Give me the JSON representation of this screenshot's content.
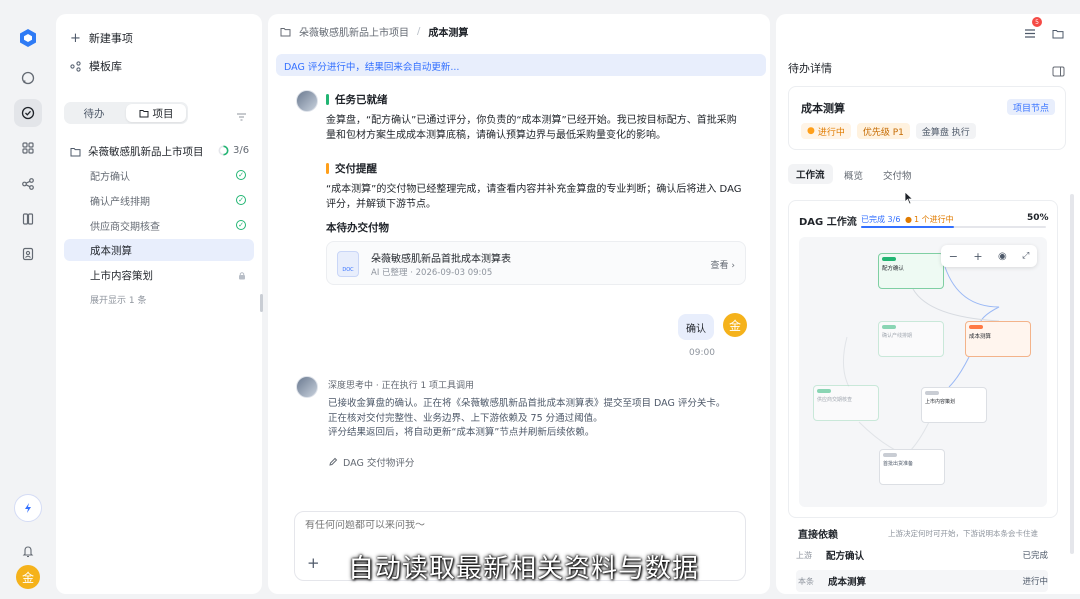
{
  "sidebar": {
    "new_item": "新建事项",
    "templates": "模板库",
    "tab_todo": "待办",
    "tab_project": "项目",
    "project_name": "朵薇敏感肌新品上市项目",
    "project_progress": "3/6",
    "tasks": [
      {
        "label": "配方确认",
        "state": "done"
      },
      {
        "label": "确认产线排期",
        "state": "done"
      },
      {
        "label": "供应商交期核查",
        "state": "done"
      },
      {
        "label": "成本测算",
        "state": "current"
      },
      {
        "label": "上市内容策划",
        "state": "locked"
      }
    ],
    "expand_more": "展开显示 1 条"
  },
  "breadcrumb": {
    "project": "朵薇敏感肌新品上市项目",
    "separator": "/",
    "current": "成本测算",
    "notif_count": "5"
  },
  "banner": "DAG 评分进行中，结果回来会自动更新...",
  "messages": {
    "task_ready_title": "任务已就绪",
    "task_ready_body": "金算盘，“配方确认”已通过评分，你负责的“成本测算”已经开始。我已按目标配方、首批采购量和包材方案生成成本测算底稿，请确认预算边界与最低采购量变化的影响。",
    "delivery_title": "交付提醒",
    "delivery_body": "“成本测算”的交付物已经整理完成，请查看内容并补充金算盘的专业判断；确认后将进入 DAG 评分，并解锁下游节点。",
    "deliverables_title": "本待办交付物",
    "file_name": "朵薇敏感肌新品首批成本测算表",
    "file_meta": "AI 已整理 · 2026-09-03 09:05",
    "file_view": "查看 ›",
    "file_badge": "DOC",
    "user_reply": "确认",
    "user_time": "09:00",
    "user_avatar": "金",
    "thinking_status": "深度思考中 · 正在执行 1 项工具调用",
    "thinking_body_1": "已接收金算盘的确认。正在将《朵薇敏感肌新品首批成本测算表》提交至项目 DAG 评分关卡。",
    "thinking_body_2": "正在核对交付完整性、业务边界、上下游依赖及 75 分通过阈值。",
    "thinking_body_3": "评分结果返回后，将自动更新“成本测算”节点并刷新后续依赖。",
    "tool_label": "DAG 交付物评分"
  },
  "input": {
    "placeholder": "有任何问题都可以来问我～"
  },
  "subtitle": "自动读取最新相关资料与数据",
  "detail": {
    "header": "待办详情",
    "task_title": "成本测算",
    "node_badge": "项目节点",
    "status": "进行中",
    "priority": "优先级 P1",
    "owner": "金算盘 执行",
    "tabs": [
      "工作流",
      "概览",
      "交付物"
    ],
    "dag_title": "DAG 工作流",
    "dag_done": "已完成 3/6",
    "dag_running": "1 个进行中",
    "dag_percent": "50%",
    "dag_progress": 0.5,
    "deps_title": "直接依赖",
    "deps_note": "上游决定何时可开始，下游说明本条会卡住谁",
    "deps": [
      {
        "role": "上游",
        "name": "配方确认",
        "state": "已完成"
      },
      {
        "role": "本条",
        "name": "成本测算",
        "state": "进行中"
      }
    ]
  },
  "user": {
    "avatar": "金"
  },
  "colors": {
    "accent": "#3370ff",
    "green": "#22b573",
    "orange": "#ff9f1a",
    "brand": "#2f7bf5"
  }
}
